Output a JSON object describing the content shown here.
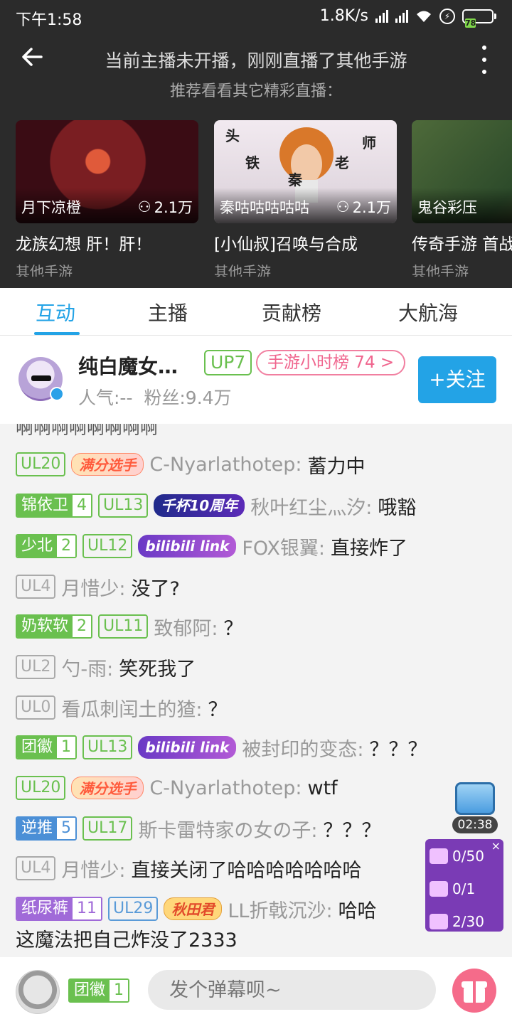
{
  "status_bar": {
    "time": "下午1:58",
    "net_speed": "1.8K/s",
    "battery": "78"
  },
  "header": {
    "line1": "当前主播未开播，刚刚直播了其他手游",
    "line2": "推荐看看其它精彩直播："
  },
  "recommendations": [
    {
      "anchor": "月下凉橙",
      "popularity": "2.1万",
      "title": "龙族幻想 肝！肝！",
      "category": "其他手游"
    },
    {
      "anchor": "秦咕咕咕咕咕",
      "popularity": "2.1万",
      "title": "[小仙叔]召唤与合成",
      "category": "其他手游",
      "overlay_chars": [
        "头",
        "铁",
        "秦",
        "老",
        "师"
      ]
    },
    {
      "anchor": "鬼谷彩压",
      "popularity": "",
      "title": "传奇手游 首战",
      "category": "其他手游"
    }
  ],
  "tabs": [
    "互动",
    "主播",
    "贡献榜",
    "大航海"
  ],
  "anchor_info": {
    "name": "纯白魔女…",
    "level": "UP7",
    "rank": "手游小时榜 74",
    "popularity_label": "人气:--",
    "fans_label": "粉丝:9.4万",
    "follow_label": "+关注"
  },
  "chat": {
    "partial_top": "啊啊啊啊啊啊啊啊",
    "messages": [
      {
        "ul": "UL20",
        "ul_color": "green",
        "title_badge": "满分选手",
        "title_style": "manfen",
        "user": "C-Nyarlathotep",
        "text": "蓄力中"
      },
      {
        "medal": "锦依卫",
        "medal_level": "4",
        "medal_color": "green",
        "ul": "UL13",
        "ul_color": "green",
        "title_badge": "千杯10周年",
        "title_style": "qianbei",
        "user": "秋叶红尘灬汐",
        "text": "哦豁"
      },
      {
        "medal": "少北",
        "medal_level": "2",
        "medal_color": "green",
        "ul": "UL12",
        "ul_color": "green",
        "title_badge": "bilibili link",
        "title_style": "bili",
        "user": "FOX银翼",
        "text": "直接炸了"
      },
      {
        "ul": "UL4",
        "ul_color": "gray",
        "user": "月惜少",
        "text": "没了?"
      },
      {
        "medal": "奶软软",
        "medal_level": "2",
        "medal_color": "green",
        "ul": "UL11",
        "ul_color": "green",
        "user": "致郁阿",
        "text": "？"
      },
      {
        "ul": "UL2",
        "ul_color": "gray",
        "user": "勺-雨",
        "text": "笑死我了"
      },
      {
        "ul": "UL0",
        "ul_color": "gray",
        "user": "看瓜刺闰土的猹",
        "text": "？"
      },
      {
        "medal": "团徽",
        "medal_level": "1",
        "medal_color": "green",
        "ul": "UL13",
        "ul_color": "green",
        "title_badge": "bilibili link",
        "title_style": "bili",
        "user": "被封印的变态",
        "text": "？？？"
      },
      {
        "ul": "UL20",
        "ul_color": "green",
        "title_badge": "满分选手",
        "title_style": "manfen",
        "user": "C-Nyarlathotep",
        "text": "wtf"
      },
      {
        "medal": "逆推",
        "medal_level": "5",
        "medal_color": "blue",
        "ul": "UL17",
        "ul_color": "green",
        "user": "斯卡雷特家の女の子",
        "text": "？？？"
      },
      {
        "ul": "UL4",
        "ul_color": "gray",
        "user": "月惜少",
        "text": "直接关闭了哈哈哈哈哈哈哈"
      },
      {
        "medal": "纸尿裤",
        "medal_level": "11",
        "medal_color": "purple",
        "ul": "UL29",
        "ul_color": "blue",
        "title_badge": "秋田君",
        "title_style": "qiutian",
        "user": "LL折戟沉沙",
        "text": "哈哈"
      }
    ],
    "wrap_line": "这魔法把自己炸没了2333"
  },
  "floating": {
    "chest_timer": "02:38",
    "tasks": [
      "0/50",
      "0/1",
      "2/30"
    ]
  },
  "bottom_bar": {
    "medal": "团徽",
    "medal_level": "1",
    "input_placeholder": "发个弹幕呗~"
  }
}
